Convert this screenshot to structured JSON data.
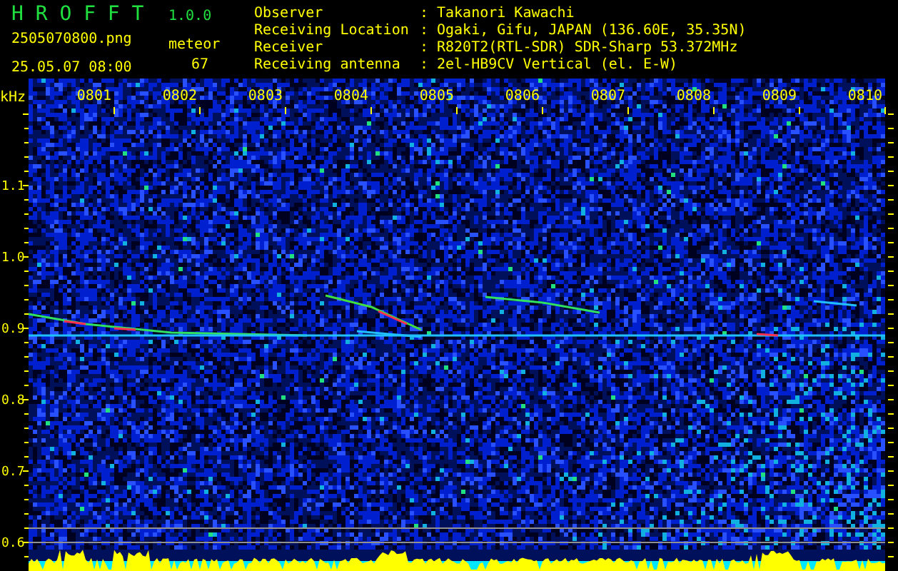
{
  "app": {
    "title": "H R O F F T",
    "version": "1.0.0"
  },
  "file": "2505070800.png",
  "datetime": "25.05.07 08:00",
  "counter": {
    "label": "meteor",
    "value": "67"
  },
  "info": [
    {
      "label": "Observer",
      "separator": ":",
      "value": "Takanori Kawachi"
    },
    {
      "label": "Receiving Location",
      "separator": ":",
      "value": "Ogaki, Gifu, JAPAN (136.60E, 35.35N)"
    },
    {
      "label": "Receiver",
      "separator": ":",
      "value": "R820T2(RTL-SDR) SDR-Sharp 53.372MHz"
    },
    {
      "label": "Receiving antenna",
      "separator": ":",
      "value": "2el-HB9CV Vertical (el. E-W)"
    }
  ],
  "spectrogram": {
    "y_unit": "kHz",
    "time_labels": [
      "0801",
      "0802",
      "0803",
      "0804",
      "0805",
      "0806",
      "0807",
      "0808",
      "0809",
      "0810"
    ],
    "frequency_labels": [
      "1.1",
      "1.0",
      "0.9",
      "0.8",
      "0.7",
      "0.6"
    ]
  }
}
